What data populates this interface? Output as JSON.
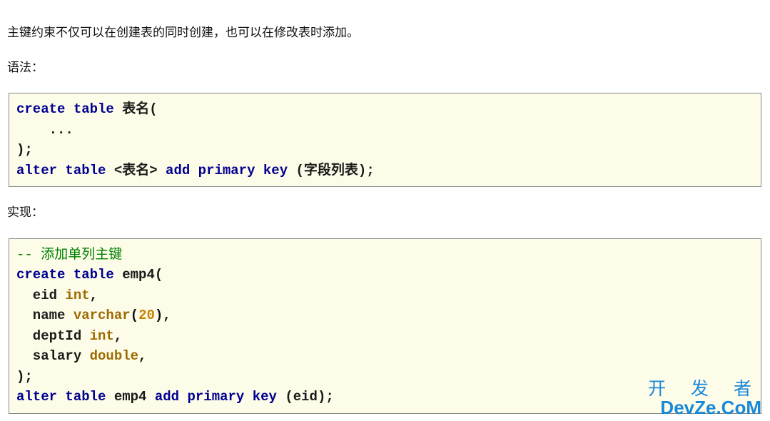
{
  "intro": "主键约束不仅可以在创建表的同时创建，也可以在修改表时添加。",
  "syntaxLabel": "语法：",
  "code1": {
    "l1a": "create",
    "l1b": "table",
    "l1c": " 表名(",
    "l2": "    ...",
    "l3": ");",
    "l4a": "alter",
    "l4b": "table",
    "l4c": " <表名> ",
    "l4d": "add",
    "l4e": "primary",
    "l4f": "key",
    "l4g": " (字段列表);"
  },
  "implLabel": "实现：",
  "code2": {
    "c1": "-- 添加单列主键",
    "l1a": "create",
    "l1b": "table",
    "l1c": " emp4(",
    "l2a": "  eid ",
    "l2b": "int",
    "l2c": ",",
    "l3a": "  name ",
    "l3b": "varchar",
    "l3c": "(",
    "l3d": "20",
    "l3e": "),",
    "l4a": "  deptId ",
    "l4b": "int",
    "l4c": ",",
    "l5a": "  salary ",
    "l5b": "double",
    "l5c": ",",
    "l6": ");",
    "l7a": "alter",
    "l7b": "table",
    "l7c": " emp4 ",
    "l7d": "add",
    "l7e": "primary",
    "l7f": "key",
    "l7g": " (eid);"
  },
  "watermark": {
    "line1": "开 发 者",
    "line2": "DevZe.CoM"
  }
}
